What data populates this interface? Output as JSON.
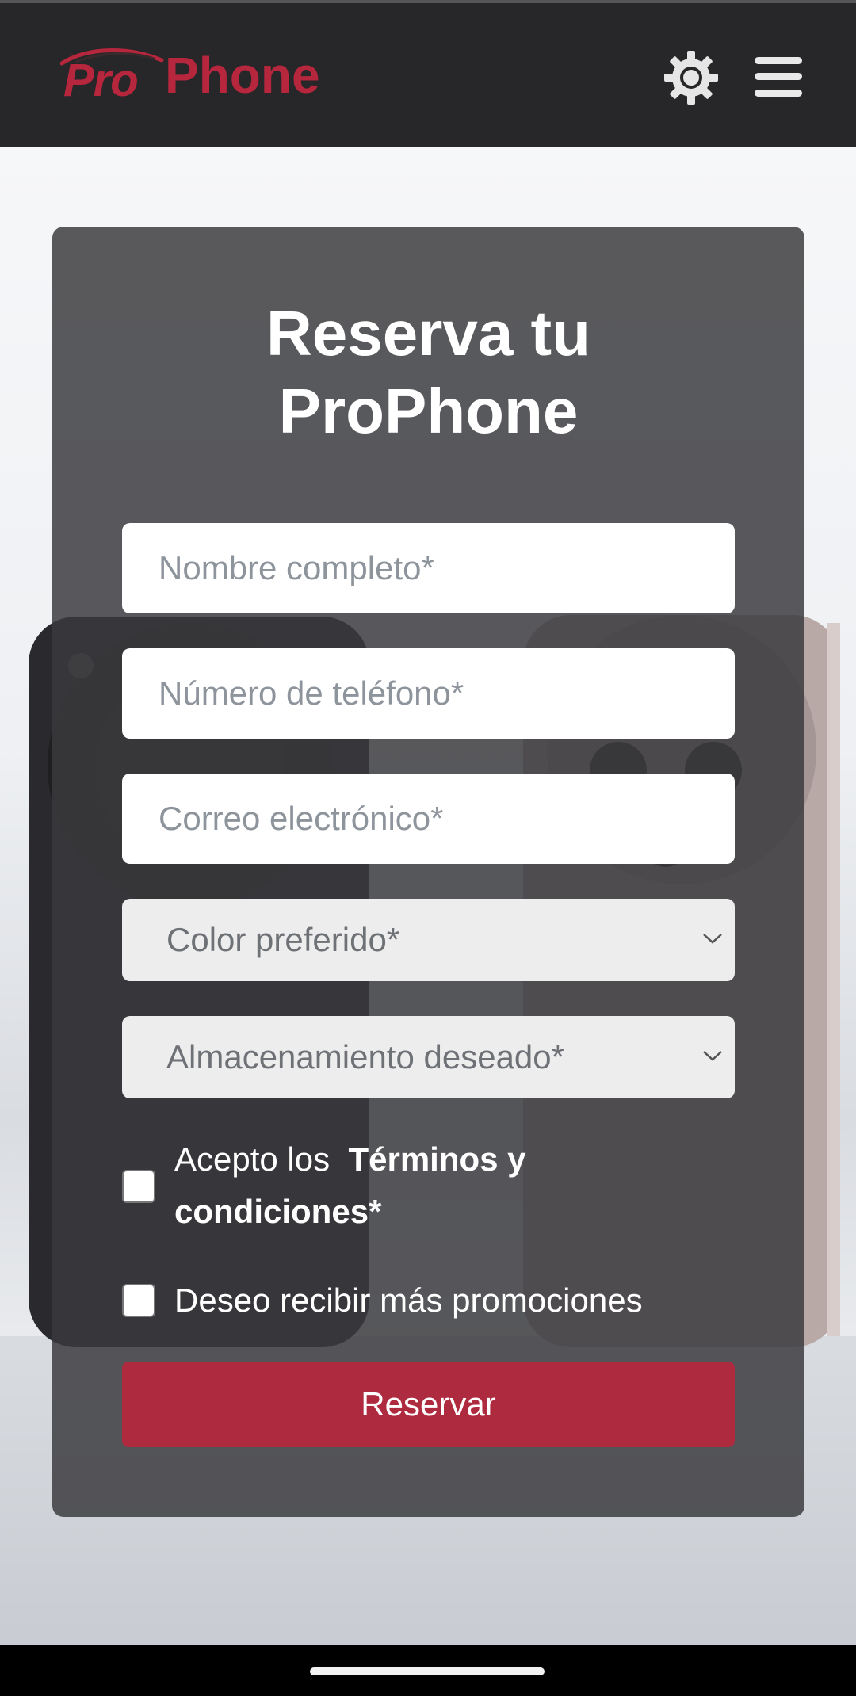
{
  "header": {
    "logo_pro": "Pro",
    "logo_phone": "Phone",
    "brand_color": "#b6263d",
    "theme_icon": "gear-icon",
    "menu_icon": "hamburger-menu-icon"
  },
  "form": {
    "title_line1": "Reserva tu",
    "title_line2": "ProPhone",
    "name_placeholder": "Nombre completo*",
    "phone_placeholder": "Número de teléfono*",
    "email_placeholder": "Correo electrónico*",
    "color_select": "Color preferido*",
    "storage_select": "Almacenamiento deseado*",
    "terms_prefix": "Acepto los",
    "terms_link": "Términos y condiciones",
    "terms_suffix": "*",
    "promo_label": "Deseo recibir más promociones",
    "submit_label": "Reservar",
    "submit_color": "#ae2a3f"
  }
}
